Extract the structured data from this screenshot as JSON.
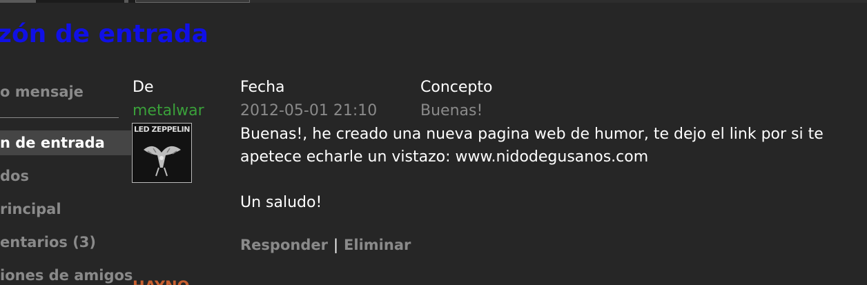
{
  "page_title": "zón de entrada",
  "nav": {
    "new_message": "o mensaje",
    "inbox": "n de entrada",
    "sent": "dos",
    "main": "rincipal",
    "comments": "entarios (3)",
    "friend_requests": "iones de amigos",
    "partial_next": "HAYNO"
  },
  "message": {
    "headers": {
      "from": "De",
      "date": "Fecha",
      "subject": "Concepto"
    },
    "sender": "metalwar",
    "sender_avatar_text": "LED ZEPPELIN",
    "date": "2012-05-01 21:10",
    "subject": "Buenas!",
    "body_line1": "Buenas!, he creado una nueva pagina web de humor, te dejo el link por si te",
    "body_line2": "apetece echarle un vistazo: www.nidodegusanos.com",
    "body_closing": "Un saludo!",
    "actions": {
      "reply": "Responder",
      "separator": "|",
      "delete": "Eliminar"
    }
  },
  "colors": {
    "background": "#262626",
    "title": "#1010e6",
    "sender_link": "#3aa03a",
    "muted": "#8a8a8a",
    "active_nav_bg": "#454545"
  }
}
